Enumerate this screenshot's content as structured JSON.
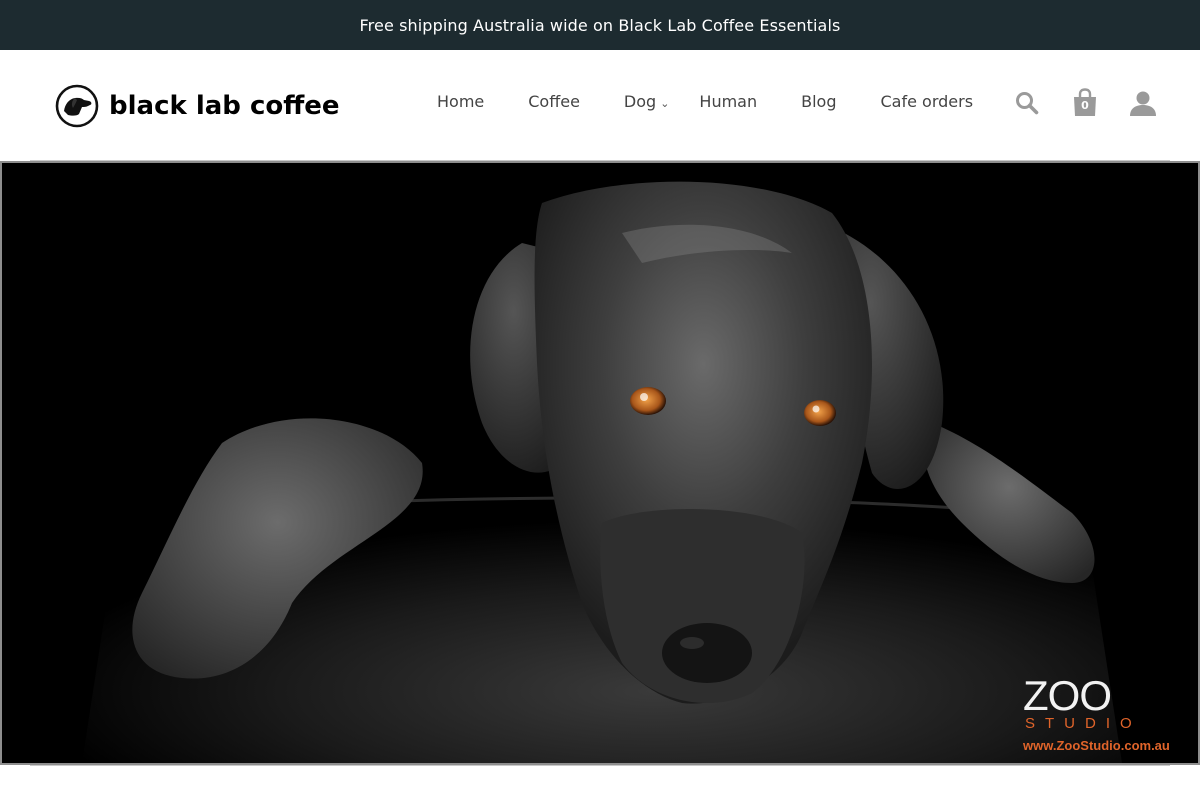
{
  "announcement": {
    "text": "Free shipping Australia wide on Black Lab Coffee Essentials"
  },
  "header": {
    "logo_text": "black lab coffee",
    "nav": [
      {
        "label": "Home"
      },
      {
        "label": "Coffee"
      },
      {
        "label": "Dog",
        "has_dropdown": true
      },
      {
        "label": "Human"
      },
      {
        "label": "Blog"
      },
      {
        "label": "Cafe orders"
      }
    ],
    "icons": {
      "search": "search-icon",
      "cart": "cart-icon",
      "account": "account-icon"
    },
    "cart_count": "0"
  },
  "hero": {
    "image_subject": "black labrador resting head on leather couch",
    "watermark": {
      "brand": "ZOO",
      "sub": "STUDIO",
      "url": "www.ZooStudio.com.au"
    }
  },
  "colors": {
    "announcement_bg": "#1d2b30",
    "nav_text": "#444444",
    "icon": "#999999",
    "watermark_accent": "#e0642a"
  }
}
